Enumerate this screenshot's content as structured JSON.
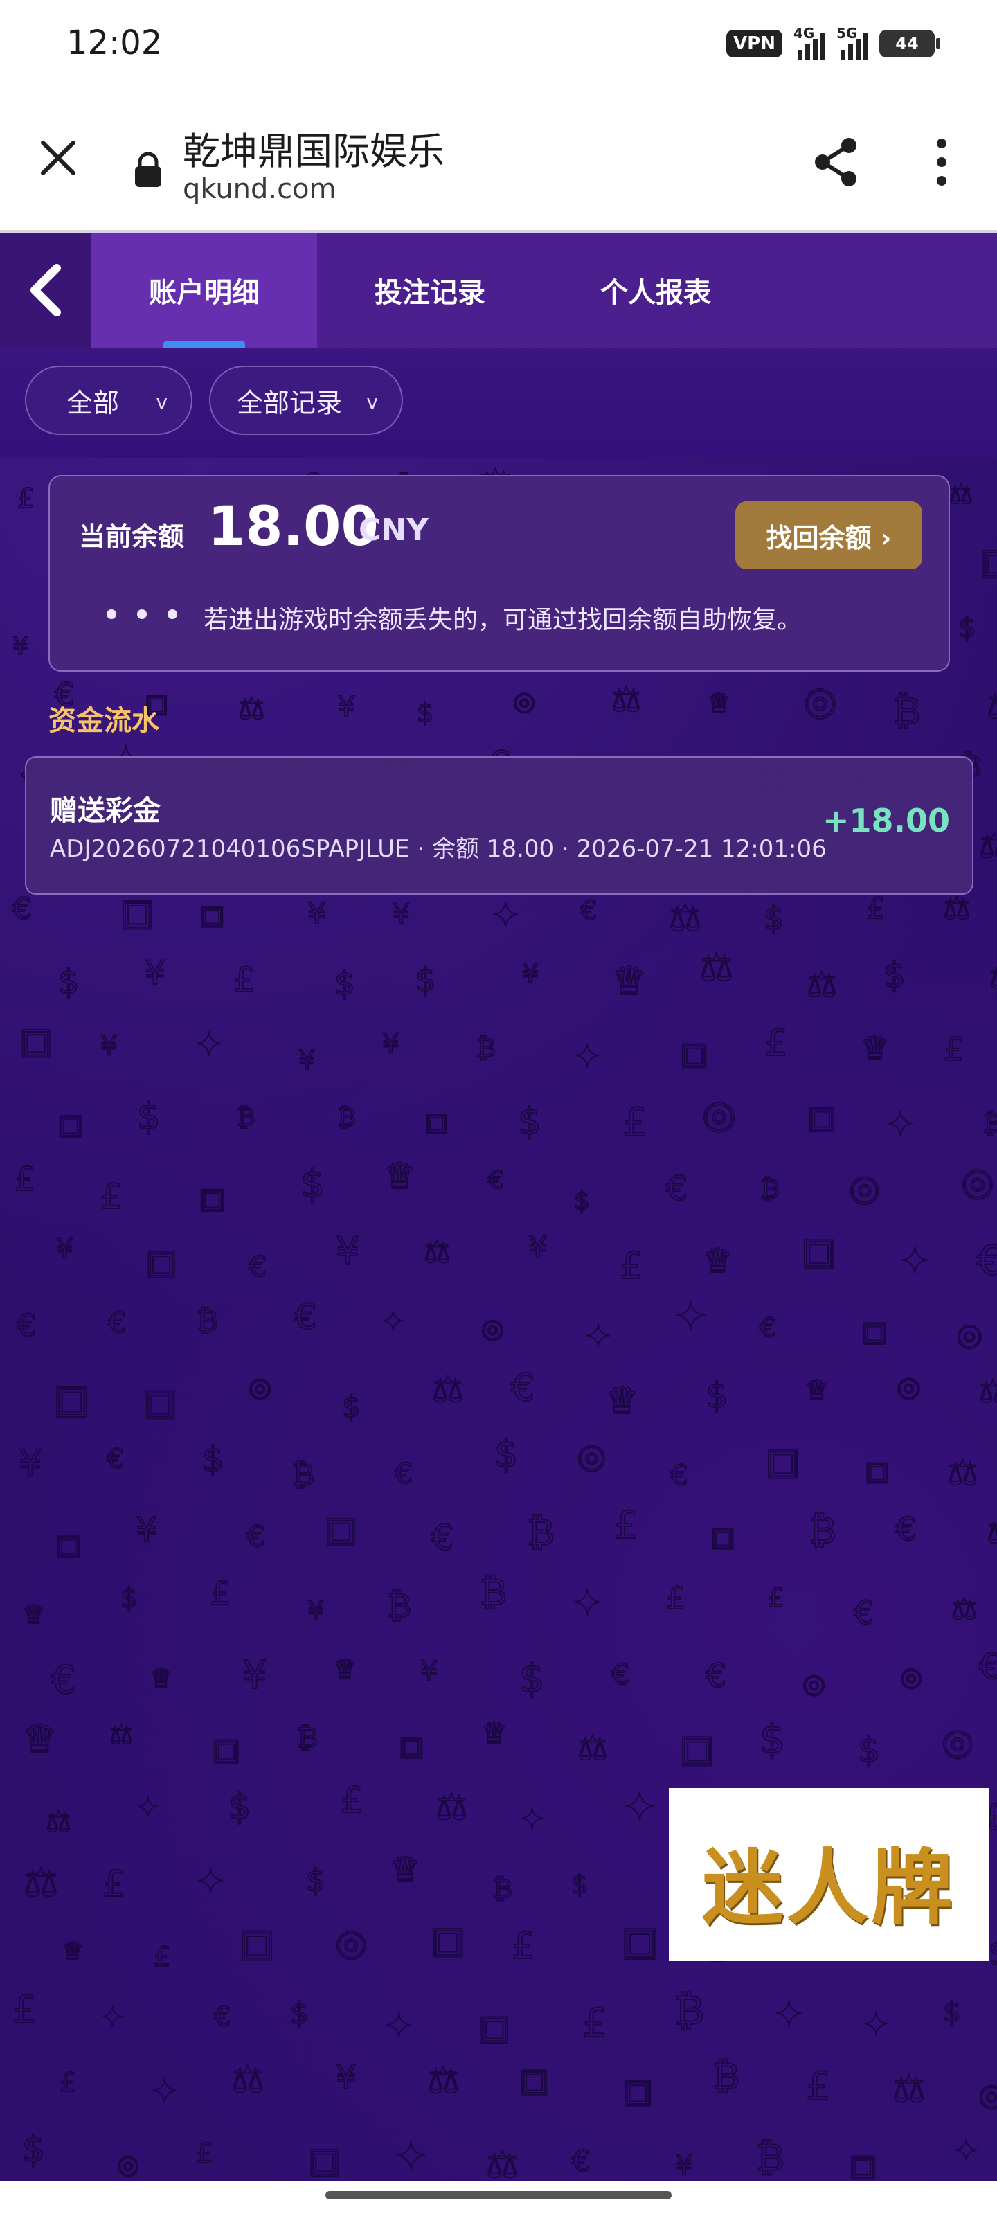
{
  "status_bar": {
    "time": "12:02",
    "vpn": "VPN",
    "net1": "4G",
    "net2": "5G",
    "battery": "44"
  },
  "browser": {
    "title": "乾坤鼎国际娱乐",
    "url": "qkund.com",
    "icons": [
      "close-icon",
      "lock-icon",
      "share-icon",
      "more-vert-icon"
    ]
  },
  "tabs": [
    {
      "label": "账户明细",
      "active": true
    },
    {
      "label": "投注记录",
      "active": false
    },
    {
      "label": "个人报表",
      "active": false
    }
  ],
  "filters": {
    "type": "全部",
    "records": "全部记录",
    "chevron": "v"
  },
  "balance": {
    "label": "当前余额",
    "value": "18.00",
    "currency": "CNY",
    "recover_button": "找回余额 ›",
    "hint": "若进出游戏时余额丢失的，可通过找回余额自助恢复。"
  },
  "section_title": "资金流水",
  "transactions": [
    {
      "title": "赠送彩金",
      "meta": "ADJ20260721040106SPAPJLUE · 余额 18.00 · 2026-07-21 12:01:06",
      "amount": "+18.00"
    }
  ],
  "promo": {
    "text": "迷人牌"
  },
  "colors": {
    "background": "#2e0f6e",
    "tab_bar": "#4b1f8e",
    "accent_gold": "#a27b3c",
    "section_title": "#f5c46a",
    "amount_positive": "#77e3c1",
    "tab_indicator": "#3f8df0"
  }
}
